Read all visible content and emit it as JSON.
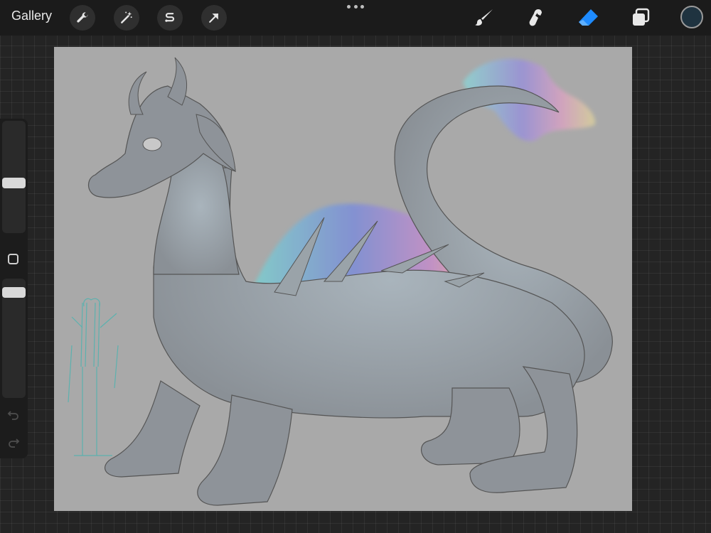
{
  "topbar": {
    "gallery_label": "Gallery",
    "left_tools": [
      "wrench-icon",
      "magic-wand-icon",
      "selection-icon",
      "transform-arrow-icon"
    ],
    "right_tools": [
      "brush-icon",
      "smudge-icon",
      "eraser-icon",
      "layers-icon"
    ],
    "active_tool": "eraser",
    "active_color": "#1f3340",
    "accent_color": "#1e8bff"
  },
  "sidebar": {
    "brush_size_level": 0.55,
    "opacity_level": 0.9
  },
  "canvas": {
    "background": "#a9a9a9",
    "subject": "dragon-artwork"
  }
}
